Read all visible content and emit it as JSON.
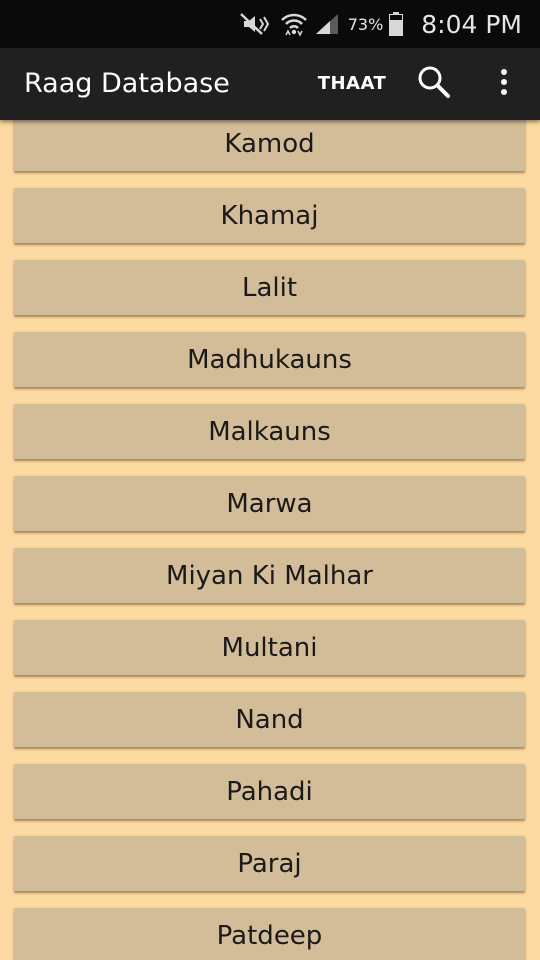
{
  "status_bar": {
    "battery_percent": "73%",
    "time": "8:04 PM"
  },
  "app_bar": {
    "title": "Raag Database",
    "thaat_action": "THAAT",
    "icons": [
      "search-icon",
      "overflow-menu-icon"
    ]
  },
  "raag_list": [
    "Kamod",
    "Khamaj",
    "Lalit",
    "Madhukauns",
    "Malkauns",
    "Marwa",
    "Miyan Ki Malhar",
    "Multani",
    "Nand",
    "Pahadi",
    "Paraj",
    "Patdeep"
  ],
  "colors": {
    "background": "#fcd9a0",
    "item": "#d3bd98",
    "app_bar": "#202020",
    "status_bar": "#0a0a0a"
  }
}
